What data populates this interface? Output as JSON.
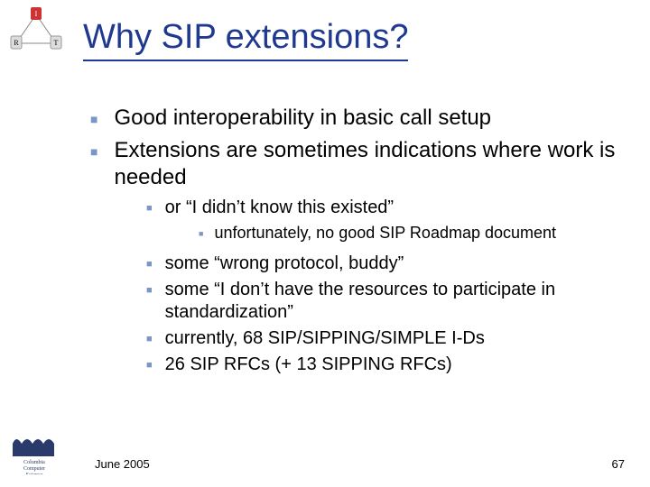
{
  "title": "Why SIP extensions?",
  "bullets_l1": [
    "Good interoperability in basic call setup",
    "Extensions are sometimes indications where work is needed"
  ],
  "sub_first": "or “I didn’t know this existed”",
  "sub_first_sub": "unfortunately, no good SIP Roadmap document",
  "sub_rest": [
    "some “wrong protocol, buddy”",
    "some “I don’t have the resources to participate in standardization”",
    "currently, 68 SIP/SIPPING/SIMPLE I-Ds",
    "26 SIP RFCs (+ 13 SIPPING RFCs)"
  ],
  "footer": {
    "date": "June 2005",
    "page": "67"
  },
  "irt": {
    "i": "I",
    "r": "R",
    "t": "T"
  },
  "chart_data": null
}
